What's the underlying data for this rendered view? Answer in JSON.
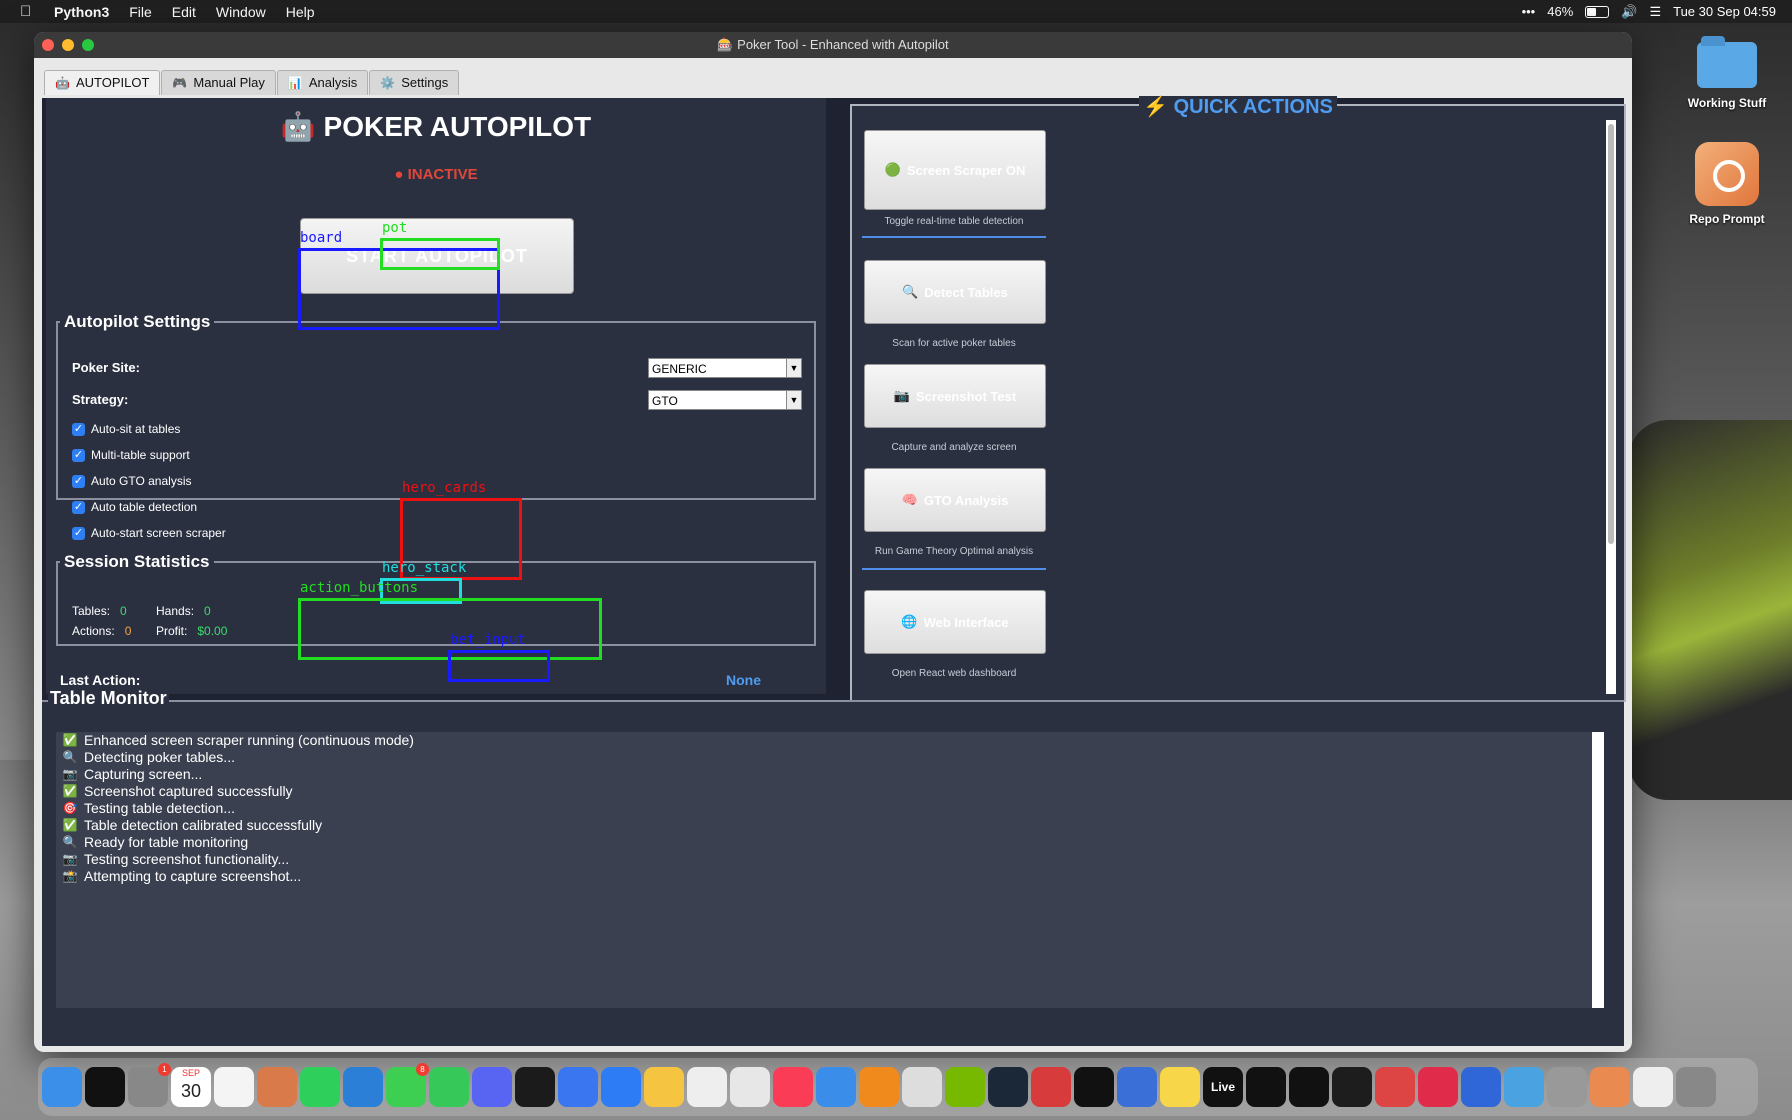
{
  "menubar": {
    "app": "Python3",
    "items": [
      "File",
      "Edit",
      "Window",
      "Help"
    ],
    "battery": "46%",
    "datetime": "Tue 30 Sep  04:59"
  },
  "desktop": {
    "folder_label": "Working Stuff",
    "app_label": "Repo Prompt"
  },
  "window": {
    "title": "🎰 Poker Tool - Enhanced with Autopilot",
    "tabs": [
      {
        "icon": "🤖",
        "label": "AUTOPILOT"
      },
      {
        "icon": "🎮",
        "label": "Manual Play"
      },
      {
        "icon": "📊",
        "label": "Analysis"
      },
      {
        "icon": "⚙️",
        "label": "Settings"
      }
    ]
  },
  "autopilot": {
    "heading": "🤖 POKER AUTOPILOT",
    "status": "● INACTIVE",
    "start_button": "START AUTOPILOT"
  },
  "settings": {
    "legend": "Autopilot Settings",
    "site_label": "Poker Site:",
    "site_value": "GENERIC",
    "strategy_label": "Strategy:",
    "strategy_value": "GTO",
    "checkboxes": [
      {
        "label": "Auto-sit at tables",
        "checked": true
      },
      {
        "label": "Multi-table support",
        "checked": true
      },
      {
        "label": "Auto GTO analysis",
        "checked": true
      },
      {
        "label": "Auto table detection",
        "checked": true
      },
      {
        "label": "Auto-start screen scraper",
        "checked": true
      }
    ]
  },
  "stats": {
    "legend": "Session Statistics",
    "tables_label": "Tables:",
    "tables": "0",
    "hands_label": "Hands:",
    "hands": "0",
    "actions_label": "Actions:",
    "actions": "0",
    "profit_label": "Profit:",
    "profit": "$0.00"
  },
  "last_action": {
    "label": "Last Action:",
    "value": "None"
  },
  "overlays": {
    "board": "board",
    "pot": "pot",
    "hero_cards": "hero_cards",
    "hero_stack": "hero_stack",
    "action_buttons": "action_buttons",
    "bet_input": "bet_input",
    "colors": {
      "blue": "#1a1aff",
      "green": "#22dd22",
      "red": "#ee1111",
      "cyan": "#22dddd"
    }
  },
  "quick_actions": {
    "title": "⚡ QUICK ACTIONS",
    "buttons": [
      {
        "icon": "🟢",
        "label": "Screen Scraper ON",
        "desc": "Toggle real-time table detection"
      },
      {
        "icon": "🔍",
        "label": "Detect Tables",
        "desc": "Scan for active poker tables"
      },
      {
        "icon": "📷",
        "label": "Screenshot Test",
        "desc": "Capture and analyze screen"
      },
      {
        "icon": "🧠",
        "label": "GTO Analysis",
        "desc": "Run Game Theory Optimal analysis"
      },
      {
        "icon": "🌐",
        "label": "Web Interface",
        "desc": "Open React web dashboard"
      }
    ]
  },
  "monitor": {
    "title": "Table Monitor",
    "log": [
      {
        "icon": "✅",
        "text": "Enhanced screen scraper running (continuous mode)"
      },
      {
        "icon": "🔍",
        "text": "Detecting poker tables..."
      },
      {
        "icon": "📷",
        "text": "Capturing screen..."
      },
      {
        "icon": "✅",
        "text": "Screenshot captured successfully"
      },
      {
        "icon": "🎯",
        "text": "Testing table detection..."
      },
      {
        "icon": "✅",
        "text": "Table detection calibrated successfully"
      },
      {
        "icon": "🔍",
        "text": "Ready for table monitoring"
      },
      {
        "icon": "📷",
        "text": "Testing screenshot functionality..."
      },
      {
        "icon": "📸",
        "text": "Attempting to capture screenshot..."
      }
    ]
  },
  "dock": {
    "calendar_month": "SEP",
    "calendar_day": "30",
    "badges": {
      "settings": "1",
      "facetime": "8"
    },
    "live_label": "Live"
  }
}
